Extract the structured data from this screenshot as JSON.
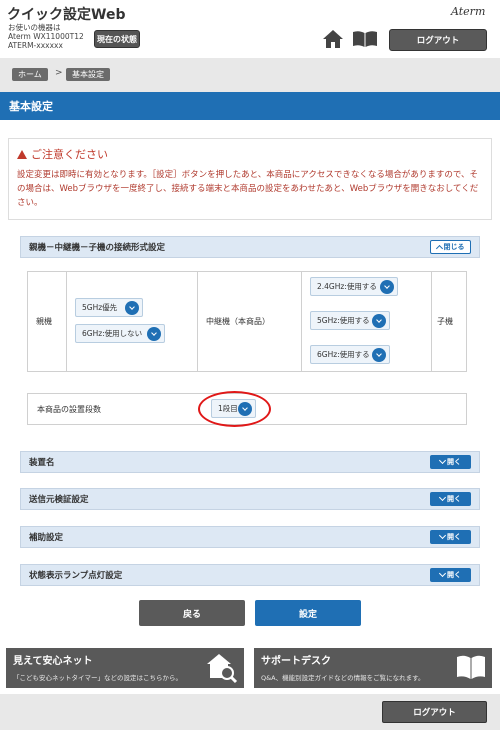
{
  "header": {
    "app_title": "クイック設定Web",
    "device_line1": "お使いの機器は",
    "device_line2": "Aterm WX11000T12",
    "device_line3": "ATERM-xxxxxx",
    "status_button": "現在の状態",
    "brand": "Aterm",
    "logout": "ログアウト",
    "home_icon": "home-icon",
    "manual_icon": "book-icon"
  },
  "breadcrumb": {
    "home": "ホーム",
    "separator": ">",
    "current": "基本設定"
  },
  "page_title": "基本設定",
  "notice": {
    "title": "ご注意ください",
    "body": "設定変更は即時に有効となります。［設定］ボタンを押したあと、本商品にアクセスできなくなる場合がありますので、その場合は、Webブラウザを一度終了し、接続する端末と本商品の設定をあわせたあと、Webブラウザを開きなおしてください。"
  },
  "connection_panel": {
    "title": "親機－中継機－子機の接続形式設定",
    "toggle_label": "閉じる",
    "parent_label": "親機",
    "parent_5ghz": "5GHz優先",
    "parent_6ghz": "6GHz:使用しない",
    "repeater_label": "中継機（本商品）",
    "repeater_24ghz": "2.4GHz:使用する",
    "repeater_5ghz": "5GHz:使用する",
    "repeater_6ghz": "6GHz:使用する",
    "child_label": "子機",
    "stage_label": "本商品の設置段数",
    "stage_value": "1段目"
  },
  "collapsed_panels": [
    {
      "title": "装置名",
      "toggle_label": "開く"
    },
    {
      "title": "送信元検証設定",
      "toggle_label": "開く"
    },
    {
      "title": "補助設定",
      "toggle_label": "開く"
    },
    {
      "title": "状態表示ランプ点灯設定",
      "toggle_label": "開く"
    }
  ],
  "actions": {
    "back": "戻る",
    "apply": "設定"
  },
  "promos": {
    "safety_title": "見えて安心ネット",
    "safety_sub": "「こども安心ネットタイマー」などの設定はこちらから。",
    "support_title": "サポートデスク",
    "support_sub": "Q&A、機能別設定ガイドなどの情報をご覧になれます。"
  },
  "footer": {
    "logout": "ログアウト"
  },
  "colors": {
    "accent": "#1f6fb4",
    "warning": "#c0392b",
    "highlight": "#e01818"
  }
}
